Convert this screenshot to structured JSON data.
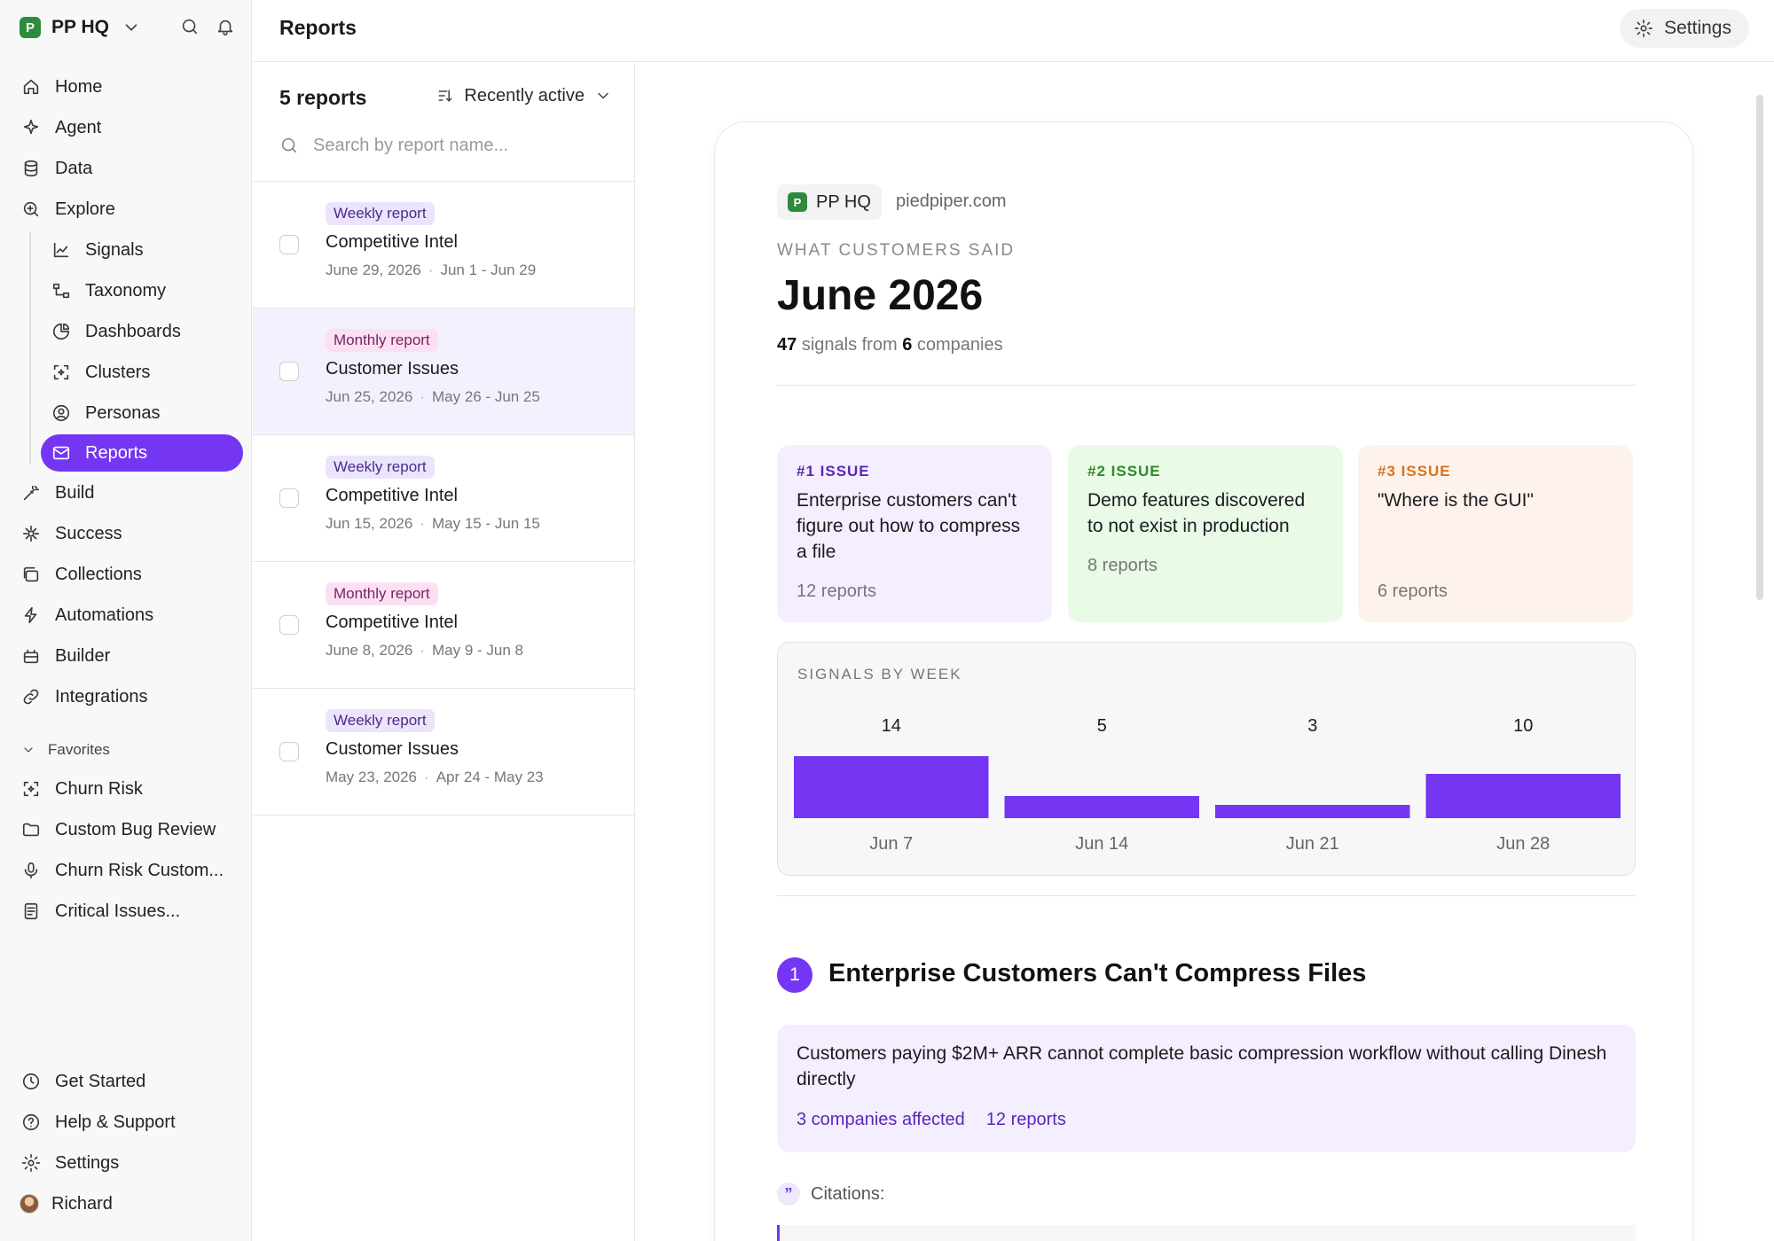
{
  "workspace": {
    "name": "PP HQ",
    "logo_letter": "P"
  },
  "sidebar": {
    "main": [
      {
        "label": "Home",
        "icon": "home-icon"
      },
      {
        "label": "Agent",
        "icon": "sparkle-icon"
      },
      {
        "label": "Data",
        "icon": "database-icon"
      },
      {
        "label": "Explore",
        "icon": "zoom-icon"
      }
    ],
    "explore_sub": [
      {
        "label": "Signals",
        "icon": "chart-icon"
      },
      {
        "label": "Taxonomy",
        "icon": "tree-icon"
      },
      {
        "label": "Dashboards",
        "icon": "pie-icon"
      },
      {
        "label": "Clusters",
        "icon": "cluster-icon"
      },
      {
        "label": "Personas",
        "icon": "persona-icon"
      },
      {
        "label": "Reports",
        "icon": "mail-icon"
      }
    ],
    "lower": [
      {
        "label": "Build",
        "icon": "wand-icon"
      },
      {
        "label": "Success",
        "icon": "success-icon"
      },
      {
        "label": "Collections",
        "icon": "collections-icon"
      },
      {
        "label": "Automations",
        "icon": "automation-icon"
      },
      {
        "label": "Builder",
        "icon": "builder-icon"
      },
      {
        "label": "Integrations",
        "icon": "link-icon"
      }
    ],
    "favorites_label": "Favorites",
    "favorites": [
      {
        "label": "Churn Risk",
        "icon": "cluster-icon"
      },
      {
        "label": "Custom Bug Review",
        "icon": "folder-icon"
      },
      {
        "label": "Churn Risk Custom...",
        "icon": "mic-icon"
      },
      {
        "label": "Critical Issues...",
        "icon": "doc-icon"
      }
    ],
    "bottom": [
      {
        "label": "Get Started",
        "icon": "clock-icon"
      },
      {
        "label": "Help & Support",
        "icon": "help-icon"
      },
      {
        "label": "Settings",
        "icon": "gear-icon"
      },
      {
        "label": "Richard",
        "icon": "avatar"
      }
    ]
  },
  "header": {
    "title": "Reports",
    "settings_label": "Settings"
  },
  "report_list": {
    "count_label": "5 reports",
    "sort_label": "Recently active",
    "search_placeholder": "Search by report name...",
    "items": [
      {
        "tag": "Weekly report",
        "name": "Competitive Intel",
        "date": "June 29, 2026",
        "range": "Jun 1 - Jun 29"
      },
      {
        "tag": "Monthly report",
        "name": "Customer Issues",
        "date": "Jun 25, 2026",
        "range": "May 26 - Jun 25"
      },
      {
        "tag": "Weekly report",
        "name": "Competitive Intel",
        "date": "Jun 15, 2026",
        "range": "May 15 - Jun 15"
      },
      {
        "tag": "Monthly report",
        "name": "Competitive Intel",
        "date": "June 8, 2026",
        "range": "May 9 - Jun 8"
      },
      {
        "tag": "Weekly report",
        "name": "Customer Issues",
        "date": "May 23, 2026",
        "range": "Apr 24 - May 23"
      }
    ]
  },
  "report": {
    "company_chip": "PP HQ",
    "domain": "piedpiper.com",
    "eyebrow": "WHAT CUSTOMERS SAID",
    "title": "June 2026",
    "signals_count": "47",
    "signals_text": "signals from",
    "companies_count": "6",
    "companies_text": "companies",
    "issues": [
      {
        "rank": "#1 ISSUE",
        "text": "Enterprise customers can't figure out how to compress a file",
        "count": "12 reports"
      },
      {
        "rank": "#2 ISSUE",
        "text": "Demo features discovered to not exist in production",
        "count": "8 reports"
      },
      {
        "rank": "#3 ISSUE",
        "text": "\"Where is the GUI\"",
        "count": "6 reports"
      }
    ],
    "section": {
      "number": "1",
      "title": "Enterprise Customers Can't Compress Files",
      "callout": "Customers paying $2M+ ARR cannot complete basic compression workflow without calling Dinesh directly",
      "companies_link": "3 companies affected",
      "reports_link": "12 reports",
      "citations_label": "Citations:"
    }
  },
  "chart_data": {
    "type": "bar",
    "title": "SIGNALS BY WEEK",
    "categories": [
      "Jun 7",
      "Jun 14",
      "Jun 21",
      "Jun 28"
    ],
    "values": [
      14,
      5,
      3,
      10
    ],
    "color": "#7436f3",
    "grid": false
  },
  "colors": {
    "accent": "#7436f3",
    "brand_green": "#2e8b3e"
  }
}
